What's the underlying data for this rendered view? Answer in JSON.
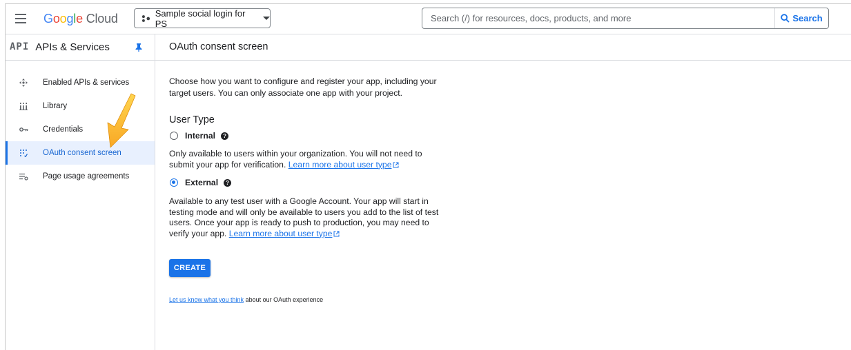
{
  "topbar": {
    "logo_google": [
      "G",
      "o",
      "o",
      "g",
      "l",
      "e"
    ],
    "logo_cloud": "Cloud",
    "project_name": "Sample social login for PS",
    "search_placeholder": "Search (/) for resources, docs, products, and more",
    "search_button": "Search"
  },
  "sidebar": {
    "badge": "API",
    "title": "APIs & Services",
    "items": [
      {
        "label": "Enabled APIs & services",
        "icon": "move-icon"
      },
      {
        "label": "Library",
        "icon": "library-icon"
      },
      {
        "label": "Credentials",
        "icon": "key-icon"
      },
      {
        "label": "OAuth consent screen",
        "icon": "consent-icon",
        "active": true
      },
      {
        "label": "Page usage agreements",
        "icon": "agreements-icon"
      }
    ]
  },
  "main": {
    "title": "OAuth consent screen",
    "intro_line1": "Choose how you want to configure and register your app, including your",
    "intro_line2": "target users. You can only associate one app with your project.",
    "section_title": "User Type",
    "internal": {
      "label": "Internal",
      "desc_line1": "Only available to users within your organization. You will not need to",
      "desc_line2": "submit your app for verification.",
      "link": "Learn more about user type"
    },
    "external": {
      "label": "External",
      "checked": true,
      "desc_line1": "Available to any test user with a Google Account. Your app will start in",
      "desc_line2": "testing mode and will only be available to users you add to the list of test",
      "desc_line3": "users. Once your app is ready to push to production, you may need to",
      "desc_line4": "verify your app.",
      "link": "Learn more about user type"
    },
    "create_button": "CREATE",
    "feedback_link": "Let us know what you think",
    "feedback_text": " about our OAuth experience"
  },
  "colors": {
    "accent": "#1a73e8",
    "active_bg": "#e8f0fe",
    "annotation_arrow": "#f9a825"
  }
}
